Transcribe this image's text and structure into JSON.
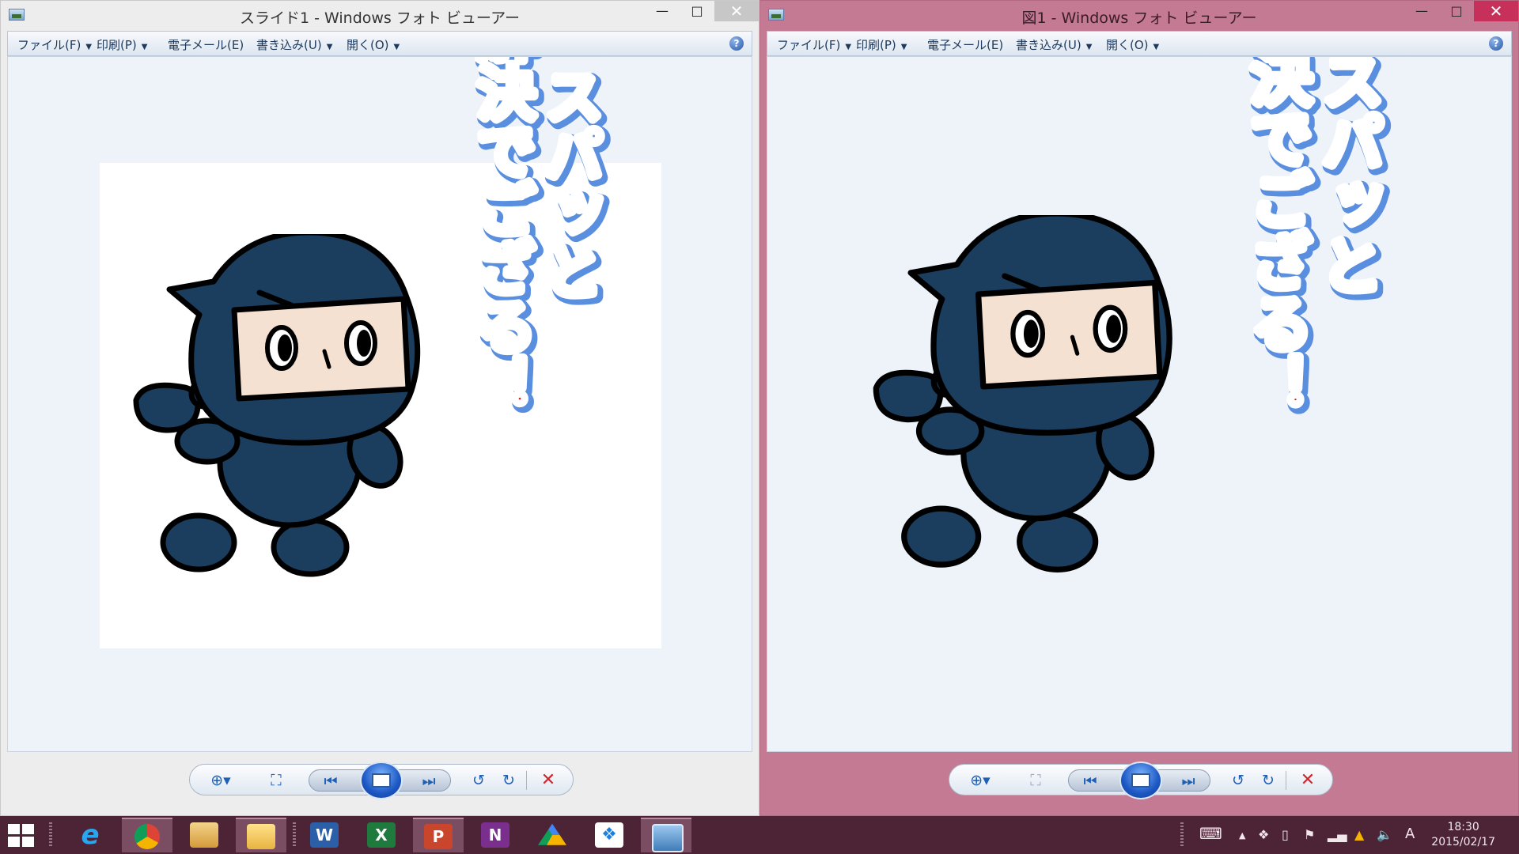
{
  "windows": {
    "left": {
      "title": "スライド1 - Windows フォト ビューアー",
      "image": {
        "kind": "slide",
        "mascot": "ninja",
        "caption_right": "スパッと",
        "caption_left": "解決でござる！"
      }
    },
    "right": {
      "title": "図1 - Windows フォト ビューアー",
      "image": {
        "kind": "picture",
        "mascot": "ninja",
        "caption_right": "スパッと",
        "caption_left": "解決でござる！"
      }
    }
  },
  "menu": {
    "file": "ファイル(F)",
    "print": "印刷(P)",
    "email": "電子メール(E)",
    "burn": "書き込み(U)",
    "open": "開く(O)"
  },
  "window_controls": {
    "minimize": "—",
    "maximize": "□",
    "close": "✕",
    "help": "?"
  },
  "toolbar_icons": [
    "zoom-icon",
    "fit-window-icon",
    "previous-icon",
    "slideshow-icon",
    "next-icon",
    "rotate-ccw-icon",
    "rotate-cw-icon",
    "delete-icon"
  ],
  "taskbar": {
    "apps": [
      "internet-explorer",
      "chrome",
      "photo-gallery",
      "file-explorer",
      "word",
      "excel",
      "powerpoint",
      "onenote",
      "google-drive",
      "dropbox",
      "photo-viewer"
    ],
    "labels": {
      "word": "W",
      "excel": "X",
      "powerpoint": "P",
      "onenote": "N",
      "ie": "e"
    },
    "tray": {
      "ime": "A"
    },
    "clock": {
      "time": "18:30",
      "date": "2015/02/17"
    }
  },
  "colors": {
    "ninja_body": "#1b3d5e",
    "ninja_face": "#f5e1d2",
    "caption_red": "#ff0d0d",
    "caption_blue_shadow": "#5a8fe0",
    "left_frame": "#ededed",
    "right_frame": "#c47a92",
    "taskbar": "#4d2436"
  }
}
